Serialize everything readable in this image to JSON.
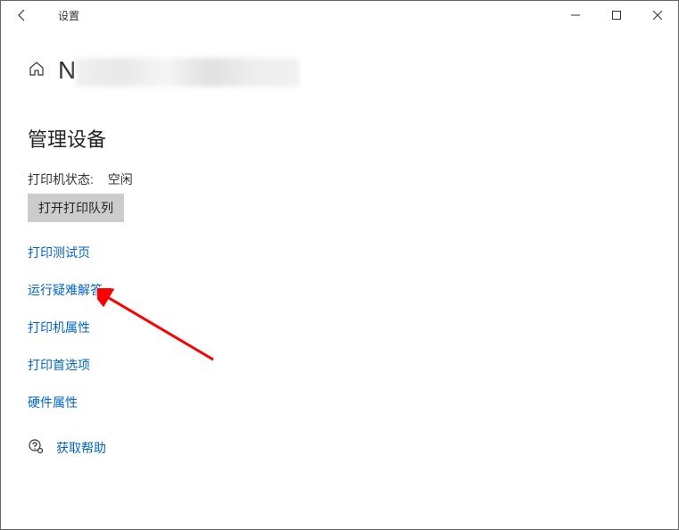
{
  "titlebar": {
    "title": "设置"
  },
  "header": {
    "device_name_prefix": "N"
  },
  "section": {
    "heading": "管理设备"
  },
  "status": {
    "label": "打印机状态:",
    "value": "空闲"
  },
  "button": {
    "open_queue": "打开打印队列"
  },
  "links": {
    "print_test_page": "打印测试页",
    "run_troubleshooter": "运行疑难解答",
    "printer_properties": "打印机属性",
    "printing_preferences": "打印首选项",
    "hardware_properties": "硬件属性"
  },
  "help": {
    "get_help": "获取帮助"
  }
}
